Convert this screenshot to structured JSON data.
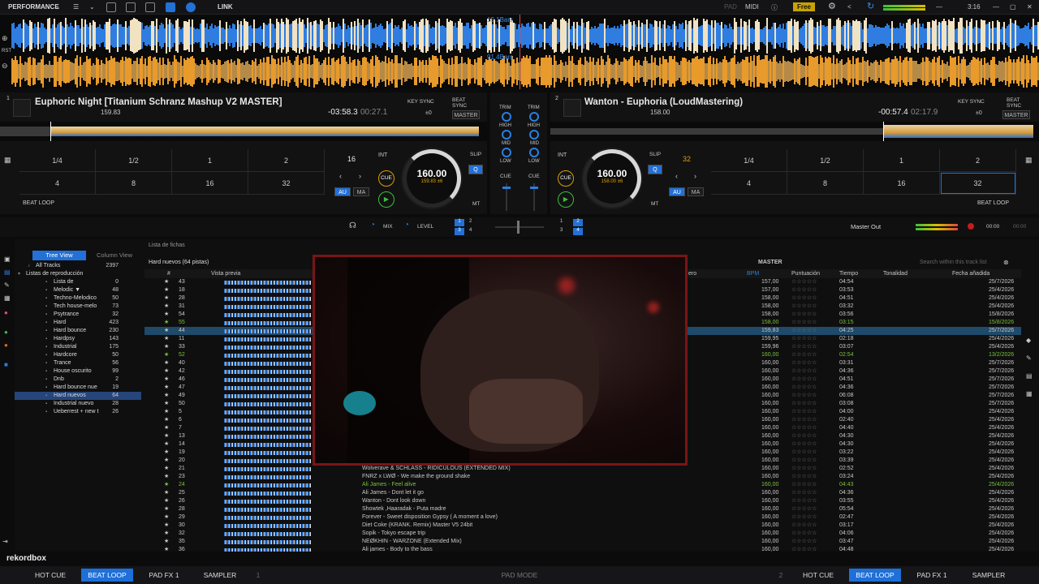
{
  "topbar": {
    "mode": "PERFORMANCE",
    "link": "LINK",
    "pad": "PAD",
    "midi": "MIDI",
    "plan": "Free",
    "clock": "3:16"
  },
  "wave": {
    "bars1": "19.1Bars",
    "bars2": "91.4Bars",
    "rst": "RST"
  },
  "deck1": {
    "num": "1",
    "title": "Euphoric Night [Titanium Schranz Mashup V2 MASTER]",
    "bpm_sub": "159.83",
    "remain": "-03:58.3",
    "elapsed": "00:27.1",
    "key_sync": "KEY SYNC",
    "beat_sync": "BEAT SYNC",
    "offset": "±0",
    "master": "MASTER",
    "loop_vals": [
      "1/4",
      "1/2",
      "1",
      "2",
      "4",
      "8",
      "16",
      "32"
    ],
    "beat_loop": "BEAT LOOP",
    "loop_len": "16",
    "int": "INT",
    "cue": "CUE",
    "au": "AU",
    "ma": "MA",
    "slip": "SLIP",
    "q": "Q",
    "mt": "MT",
    "bpm": "160.00",
    "bpm_small": "159.83",
    "pitch": "±6"
  },
  "deck2": {
    "num": "2",
    "title": "Wanton - Euphoria (LoudMastering)",
    "bpm_sub": "158.00",
    "remain": "-00:57.4",
    "elapsed": "02:17.9",
    "key_sync": "KEY SYNC",
    "beat_sync": "BEAT SYNC",
    "offset": "±0",
    "master": "MASTER",
    "loop_vals": [
      "1/4",
      "1/2",
      "1",
      "2",
      "4",
      "8",
      "16",
      "32"
    ],
    "beat_loop": "BEAT LOOP",
    "loop_len": "32",
    "int": "INT",
    "cue": "CUE",
    "au": "AU",
    "ma": "MA",
    "slip": "SLIP",
    "q": "Q",
    "mt": "MT",
    "bpm": "160.00",
    "bpm_small": "158.00",
    "pitch": "±6"
  },
  "mixer": {
    "trim": "TRIM",
    "high": "HIGH",
    "mid": "MID",
    "low": "LOW",
    "cue": "CUE",
    "mix": "MIX",
    "level": "LEVEL",
    "master_out": "Master Out",
    "time1": "00:00",
    "time2": "00:00"
  },
  "browser": {
    "list_label": "Lista de fichas",
    "tree_view": "Tree View",
    "column_view": "Column View",
    "playlist_name": "Hard nuevos (64 pistas)",
    "master": "MASTER",
    "search_placeholder": "Search within this track list",
    "cols": {
      "hash": "#",
      "preview": "Vista previa",
      "genre": "ero",
      "bpm": "BPM",
      "rating": "Puntuación",
      "time": "Tiempo",
      "key": "Tonalidad",
      "date": "Fecha añadida"
    },
    "tree": [
      {
        "label": "All Tracks",
        "count": "2397"
      },
      {
        "label": "Listas de reproducción",
        "count": ""
      },
      {
        "label": "Lista de",
        "count": "0"
      },
      {
        "label": "Melodic ▼",
        "count": "48"
      },
      {
        "label": "Techno-Melodico",
        "count": "50"
      },
      {
        "label": "Tech house-melo",
        "count": "73"
      },
      {
        "label": "Psytrance",
        "count": "32"
      },
      {
        "label": "Hard",
        "count": "423"
      },
      {
        "label": "Hard bounce",
        "count": "230"
      },
      {
        "label": "Hardpsy",
        "count": "143"
      },
      {
        "label": "Industrial",
        "count": "175"
      },
      {
        "label": "Hardcore",
        "count": "50"
      },
      {
        "label": "Trance",
        "count": "56"
      },
      {
        "label": "House oscurito",
        "count": "99"
      },
      {
        "label": "Dnb",
        "count": "2"
      },
      {
        "label": "Hard bounce nue",
        "count": "19"
      },
      {
        "label": "Hard nuevos",
        "count": "64"
      },
      {
        "label": "Industrial nuevo",
        "count": "28"
      },
      {
        "label": "Ueberrest + new t",
        "count": "26"
      }
    ],
    "rows": [
      {
        "no": "43",
        "bpm": "157,00",
        "time": "04:54",
        "date": "25/7/2026"
      },
      {
        "no": "18",
        "bpm": "157,00",
        "time": "03:53",
        "date": "25/4/2026"
      },
      {
        "no": "28",
        "bpm": "158,00",
        "time": "04:51",
        "date": "25/4/2026"
      },
      {
        "no": "31",
        "bpm": "158,00",
        "time": "03:32",
        "date": "25/4/2026"
      },
      {
        "no": "54",
        "bpm": "158,00",
        "time": "03:56",
        "date": "15/8/2026"
      },
      {
        "no": "55",
        "bpm": "158,00",
        "time": "03:15",
        "date": "15/8/2026"
      },
      {
        "no": "44",
        "bpm": "159,83",
        "time": "04:25",
        "date": "25/7/2026"
      },
      {
        "no": "11",
        "bpm": "159,95",
        "time": "02:18",
        "date": "25/4/2026"
      },
      {
        "no": "33",
        "bpm": "159,96",
        "time": "03:07",
        "date": "25/4/2026"
      },
      {
        "no": "52",
        "bpm": "160,00",
        "time": "02:54",
        "date": "13/2/2026"
      },
      {
        "no": "40",
        "bpm": "160,00",
        "time": "03:31",
        "date": "25/7/2026"
      },
      {
        "no": "42",
        "bpm": "160,00",
        "time": "04:36",
        "date": "25/7/2026"
      },
      {
        "no": "46",
        "bpm": "160,00",
        "time": "04:51",
        "date": "25/7/2026"
      },
      {
        "no": "47",
        "bpm": "160,00",
        "time": "04:36",
        "date": "25/7/2026"
      },
      {
        "no": "49",
        "bpm": "160,00",
        "time": "06:08",
        "date": "25/7/2026"
      },
      {
        "no": "50",
        "bpm": "160,00",
        "time": "03:08",
        "date": "25/7/2026"
      },
      {
        "no": "5",
        "bpm": "160,00",
        "time": "04:00",
        "date": "25/4/2026"
      },
      {
        "no": "6",
        "bpm": "160,00",
        "time": "02:40",
        "date": "25/4/2026"
      },
      {
        "no": "7",
        "bpm": "160,00",
        "time": "04:40",
        "date": "25/4/2026"
      },
      {
        "no": "13",
        "bpm": "160,00",
        "time": "04:30",
        "date": "25/4/2026"
      },
      {
        "no": "14",
        "bpm": "160,00",
        "time": "04:30",
        "date": "25/4/2026"
      },
      {
        "no": "19",
        "bpm": "160,00",
        "time": "03:22",
        "date": "25/4/2026"
      },
      {
        "no": "20",
        "bpm": "160,00",
        "time": "03:39",
        "date": "25/4/2026"
      },
      {
        "no": "21",
        "title": "Wolverave & SCHLASS - RIDICULOUS (EXTENDED MIX)",
        "bpm": "160,00",
        "time": "02:52",
        "date": "25/4/2026"
      },
      {
        "no": "23",
        "title": "FNRZ x LWØ - We make the ground shake",
        "bpm": "160,00",
        "time": "03:24",
        "date": "25/4/2026"
      },
      {
        "no": "24",
        "title": "Ali James - Feel alive",
        "bpm": "160,00",
        "time": "04:43",
        "date": "25/4/2026"
      },
      {
        "no": "25",
        "title": "Ali James - Dont let it go",
        "bpm": "160,00",
        "time": "04:36",
        "date": "25/4/2026"
      },
      {
        "no": "26",
        "title": "Wanton - Dont look down",
        "bpm": "160,00",
        "time": "03:55",
        "date": "25/4/2026"
      },
      {
        "no": "28",
        "title": "Showtek ,Haaradak - Puta madre",
        "bpm": "160,00",
        "time": "05:54",
        "date": "25/4/2026"
      },
      {
        "no": "29",
        "title": "Forever - Sweet disposition Gypsy ( A moment a love)",
        "bpm": "160,00",
        "time": "02:47",
        "date": "25/4/2026"
      },
      {
        "no": "30",
        "title": "Diet Coke (KRANK. Remix) Master V5 24bit",
        "bpm": "160,00",
        "time": "03:17",
        "date": "25/4/2026"
      },
      {
        "no": "32",
        "title": "Sopik - Tokyo escape trip",
        "bpm": "160,00",
        "time": "04:06",
        "date": "25/4/2026"
      },
      {
        "no": "35",
        "title": "NEØKHIN - WARZONE (Extended Mix)",
        "bpm": "160,00",
        "time": "03:47",
        "date": "25/4/2026"
      },
      {
        "no": "36",
        "title": "Ali james - Body to the bass",
        "bpm": "160,00",
        "time": "04:48",
        "date": "25/4/2026"
      }
    ]
  },
  "bottom": {
    "hot_cue": "HOT CUE",
    "beat_loop": "BEAT LOOP",
    "pad_fx": "PAD FX 1",
    "sampler": "SAMPLER",
    "deck1": "1",
    "deck2": "2",
    "pad_mode": "PAD MODE"
  },
  "brand": {
    "logo": "rekordbox"
  },
  "colors": {
    "accent": "#2371d6",
    "wave_orange": "#e89a2a",
    "wave_blue": "#2f7de0",
    "playing_green": "#79c13a"
  }
}
